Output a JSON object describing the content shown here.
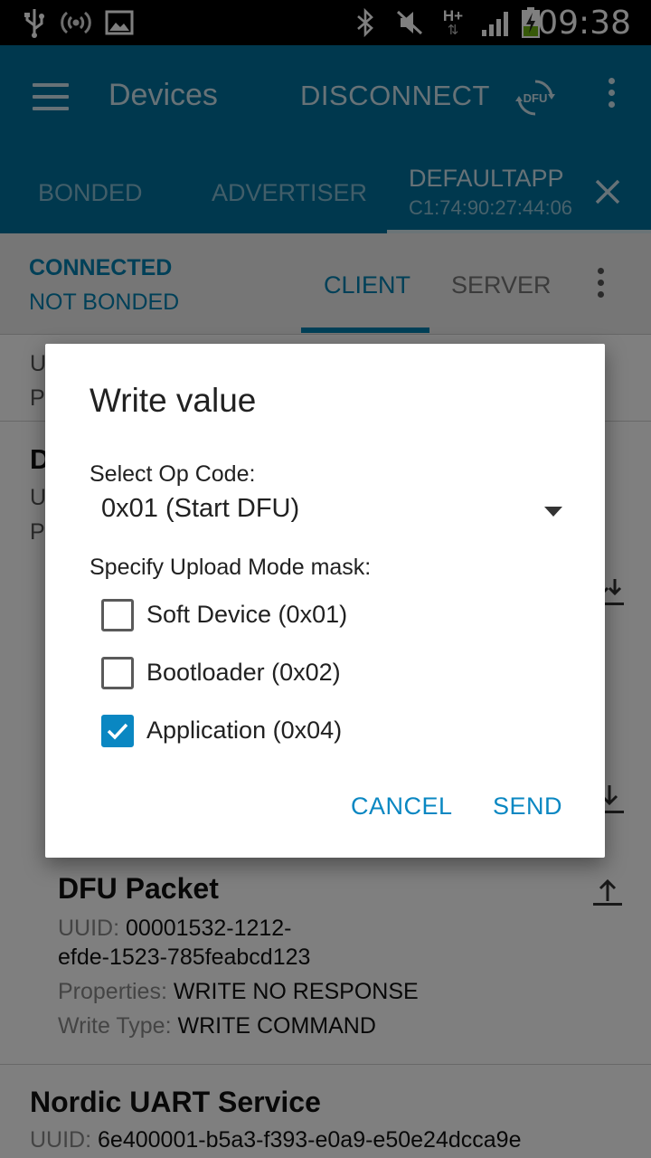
{
  "status_bar": {
    "time": "09:38",
    "network_label": "H+",
    "icons": [
      "usb-icon",
      "broadcast-icon",
      "gallery-icon",
      "bluetooth-icon",
      "mute-icon",
      "data-arrows-icon",
      "signal-icon",
      "battery-charging-icon"
    ]
  },
  "app_bar": {
    "title": "Devices",
    "disconnect_label": "DISCONNECT",
    "dfu_icon_text": "DFU",
    "tabs": [
      {
        "label": "BONDED"
      },
      {
        "label": "ADVERTISER"
      },
      {
        "label": "DEFAULTAPP",
        "address": "C1:74:90:27:44:06"
      }
    ]
  },
  "subheader": {
    "state": "CONNECTED",
    "bond_state": "NOT BONDED",
    "tabs": [
      {
        "label": "CLIENT"
      },
      {
        "label": "SERVER"
      }
    ]
  },
  "content": {
    "fragments": [
      "U",
      "P",
      "D",
      "U",
      "P"
    ],
    "dfu_packet": {
      "title": "DFU Packet",
      "uuid_label": "UUID:",
      "uuid_line1": "00001532-1212-",
      "uuid_line2": "efde-1523-785feabcd123",
      "properties_label": "Properties:",
      "properties_value": "WRITE NO RESPONSE",
      "write_type_label": "Write Type:",
      "write_type_value": "WRITE COMMAND"
    },
    "nordic_uart": {
      "title": "Nordic UART Service",
      "uuid_label": "UUID:",
      "uuid_value": "6e400001-b5a3-f393-e0a9-e50e24dcca9e"
    }
  },
  "dialog": {
    "title": "Write value",
    "op_code_label": "Select Op Code:",
    "op_code_value": "0x01 (Start DFU)",
    "mask_label": "Specify Upload Mode mask:",
    "options": [
      {
        "label": "Soft Device (0x01)",
        "checked": false
      },
      {
        "label": "Bootloader (0x02)",
        "checked": false
      },
      {
        "label": "Application (0x04)",
        "checked": true
      }
    ],
    "cancel_label": "CANCEL",
    "send_label": "SEND"
  },
  "colors": {
    "primary": "#00709c",
    "accent": "#0a87c2",
    "status_bar": "#000000"
  }
}
